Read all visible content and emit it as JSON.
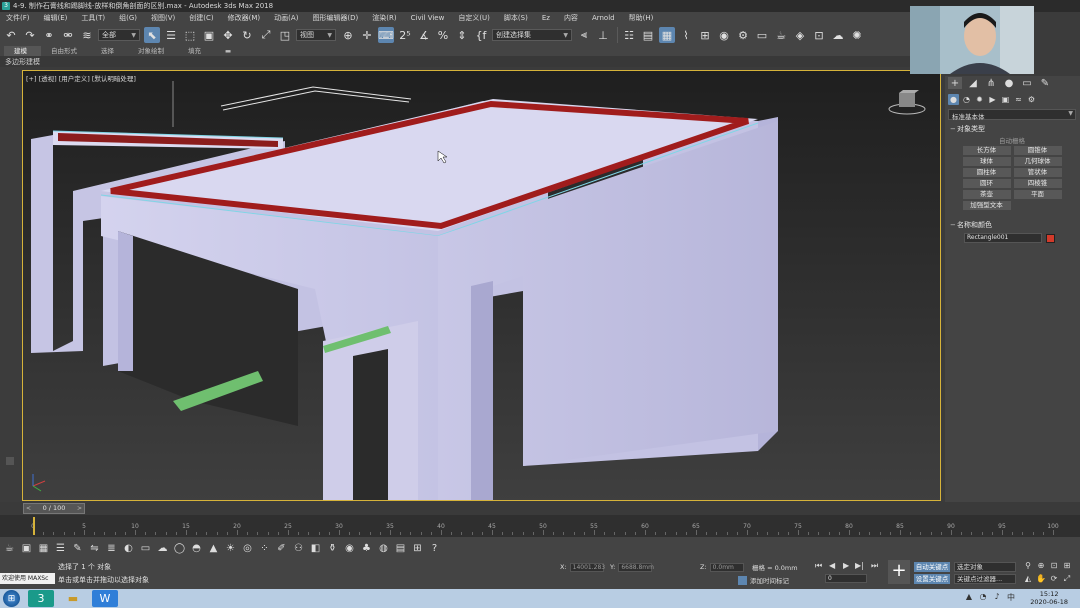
{
  "window": {
    "title": "4-9. 制作石膏线和踢脚线-放样和倒角剖面的区别.max - Autodesk 3ds Max 2018"
  },
  "menubar": {
    "items": [
      "文件(F)",
      "编辑(E)",
      "工具(T)",
      "组(G)",
      "视图(V)",
      "创建(C)",
      "修改器(M)",
      "动画(A)",
      "图形编辑器(D)",
      "渲染(R)",
      "Civil View",
      "自定义(U)",
      "脚本(S)",
      "Ez",
      "内容",
      "Arnold",
      "帮助(H)"
    ]
  },
  "toolbar": {
    "selection_filter": "全部",
    "ref_coord": "视图",
    "named_selection": "创建选择集",
    "icons": [
      "undo-icon",
      "redo-icon",
      "link-icon",
      "unlink-icon",
      "bind-space-warp-icon",
      "select-object-icon",
      "select-by-name-icon",
      "rect-region-icon",
      "window-crossing-icon",
      "move-icon",
      "rotate-icon",
      "scale-icon",
      "pivot-icon",
      "mirror-icon",
      "snap-icon",
      "angle-snap-icon",
      "percent-snap-icon",
      "spinner-snap-icon",
      "edit-named-sel-icon",
      "align-icon",
      "layer-icon",
      "scene-explorer-icon",
      "curve-editor-icon",
      "schematic-icon",
      "material-editor-icon",
      "render-setup-icon",
      "rendered-frame-icon",
      "render-icon"
    ]
  },
  "ribbon": {
    "tabs": [
      "建模",
      "自由形式",
      "选择",
      "对象绘制",
      "填充"
    ],
    "active_tab": "建模",
    "sub_label": "多边形建模"
  },
  "viewport": {
    "label": "[+] [透视] [用户定义] [默认明暗处理]"
  },
  "command_panel": {
    "category_dropdown": "标准基本体",
    "object_type_header": "对象类型",
    "autogrid_label": "自动栅格",
    "object_buttons": [
      "长方体",
      "圆锥体",
      "球体",
      "几何球体",
      "圆柱体",
      "管状体",
      "圆环",
      "四棱锥",
      "茶壶",
      "平面",
      "加强型文本"
    ],
    "name_color_header": "名称和颜色",
    "object_name": "Rectangle001",
    "object_color": "#d23a2a"
  },
  "timeslider": {
    "current": "0 / 100",
    "left_arrow": "<",
    "right_arrow": ">"
  },
  "trackbar": {
    "ticks": [
      "0",
      "5",
      "10",
      "15",
      "20",
      "25",
      "30",
      "35",
      "40",
      "45",
      "50",
      "55",
      "60",
      "65",
      "70",
      "75",
      "80",
      "85",
      "90",
      "95",
      "100"
    ]
  },
  "status": {
    "maxscript": "欢迎使用 MAXSc",
    "line1": "选择了 1 个 对象",
    "line2": "单击或单击并拖动以选择对象",
    "x_label": "X:",
    "x_value": "14001.283",
    "y_label": "Y:",
    "y_value": "6688.8mm",
    "z_label": "Z:",
    "z_value": "0.0mm",
    "grid": "栅格 = 0.0mm",
    "add_time_tag": "添加时间标记",
    "frame": "0",
    "auto_key": "自动关键点",
    "set_key": "设置关键点",
    "key_select": "选定对象",
    "key_filters": "关键点过滤器..."
  },
  "taskbar": {
    "time": "15:12",
    "date": "2020-06-18"
  }
}
